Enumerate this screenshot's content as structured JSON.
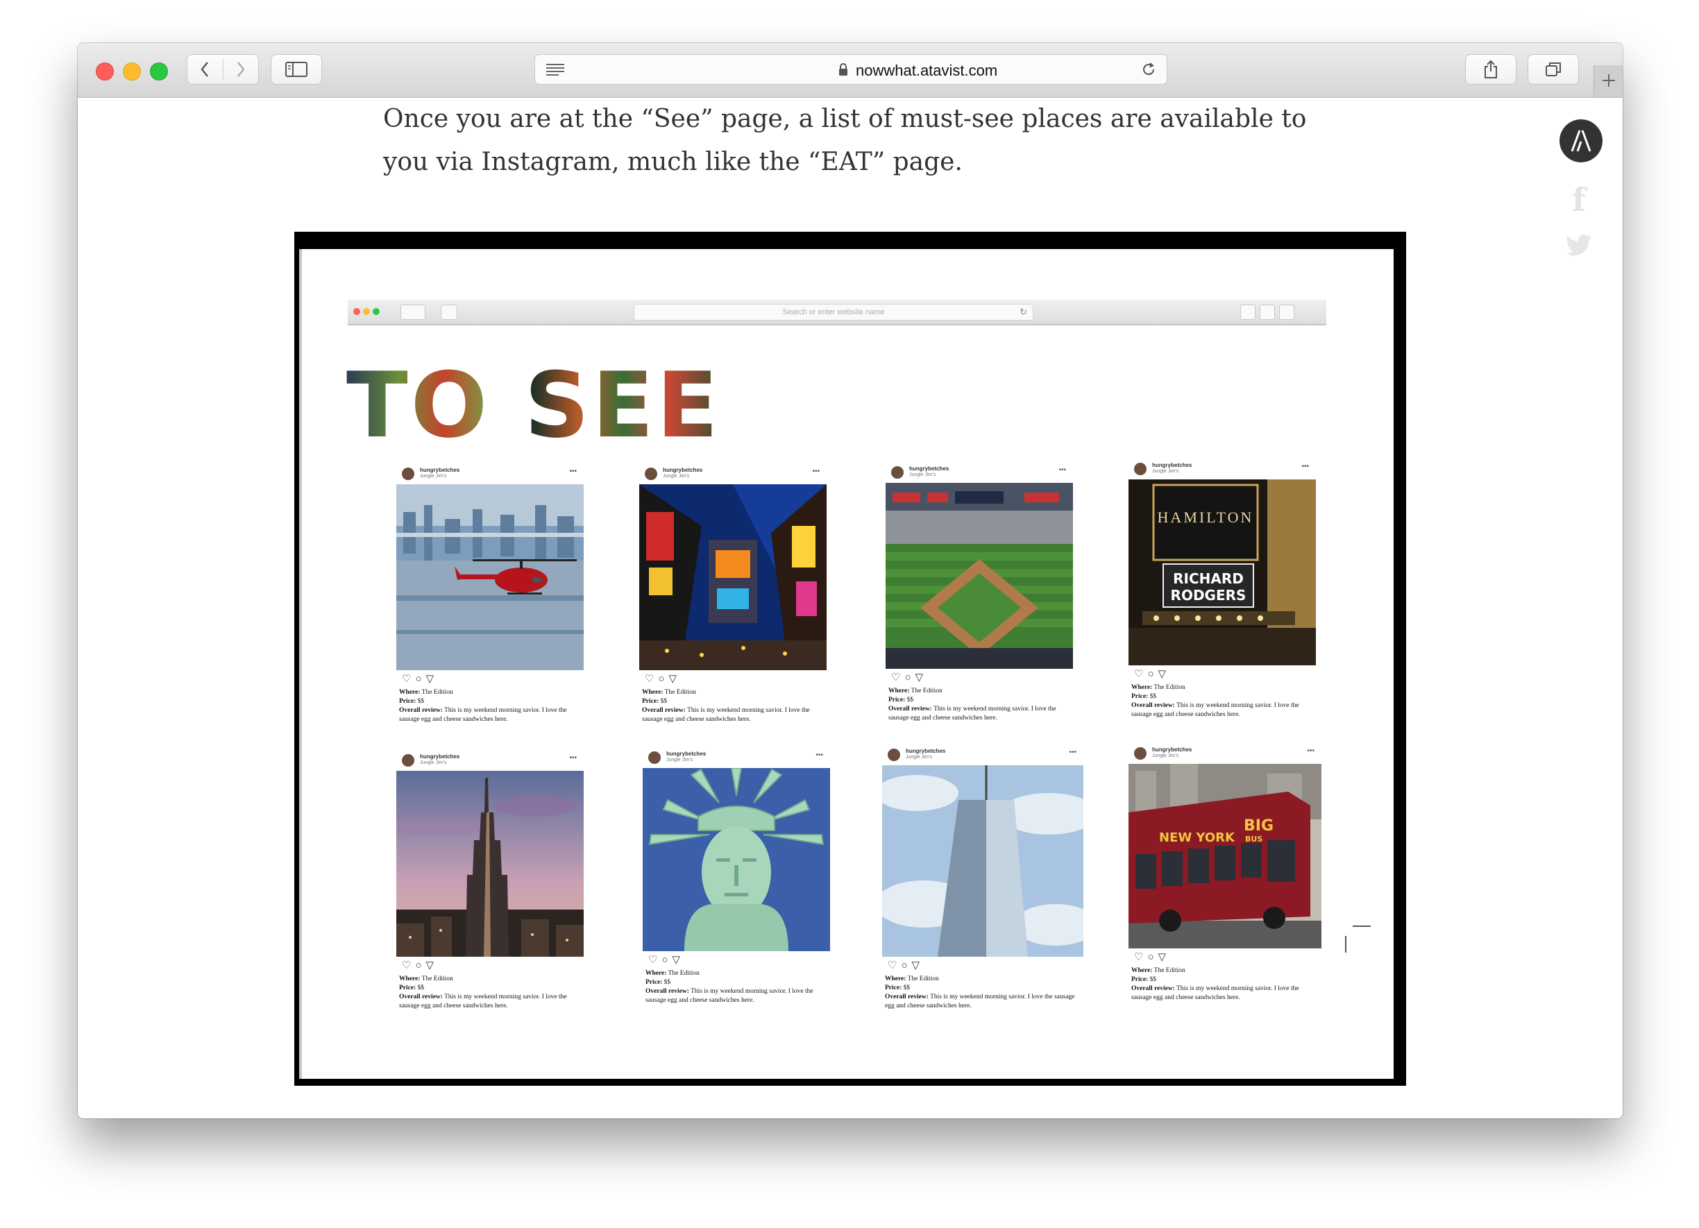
{
  "browser": {
    "url": "nowwhat.atavist.com",
    "mini_address_placeholder": "Search or enter website name"
  },
  "article": {
    "intro_text": "Once you are at the “See” page, a list of must-see places are available to you via Instagram, much like the “EAT” page."
  },
  "social": {
    "facebook_glyph": "f"
  },
  "screenshot": {
    "heading": "TO SEE",
    "posts": [
      {
        "user": "hungrybetches",
        "location": "Jungle Jim's",
        "image": "helicopter-over-city",
        "where_label": "Where:",
        "where": "The Edition",
        "price_label": "Price:",
        "price": "$$",
        "review_label": "Overall review:",
        "review": "This is my weekend morning savior. I love the sausage egg and cheese sandwiches here."
      },
      {
        "user": "hungrybetches",
        "location": "Jungle Jim's",
        "image": "times-square",
        "where_label": "Where:",
        "where": "The Edition",
        "price_label": "Price:",
        "price": "$$",
        "review_label": "Overall review:",
        "review": "This is my weekend morning savior. I love the sausage egg and cheese sandwiches here."
      },
      {
        "user": "hungrybetches",
        "location": "Jungle Jim's",
        "image": "yankee-stadium",
        "where_label": "Where:",
        "where": "The Edition",
        "price_label": "Price:",
        "price": "$$",
        "review_label": "Overall review:",
        "review": "This is my weekend morning savior. I love the sausage egg and cheese sandwiches here."
      },
      {
        "user": "hungrybetches",
        "location": "Jungle Jim's",
        "image": "hamilton-marquee",
        "sign_line1": "HAMILTON",
        "sign_line2": "RICHARD",
        "sign_line3": "RODGERS",
        "where_label": "Where:",
        "where": "The Edition",
        "price_label": "Price:",
        "price": "$$",
        "review_label": "Overall review:",
        "review": "This is my weekend morning savior. I love the sausage egg and cheese sandwiches here."
      },
      {
        "user": "hungrybetches",
        "location": "Jungle Jim's",
        "image": "empire-state-building",
        "where_label": "Where:",
        "where": "The Edition",
        "price_label": "Price:",
        "price": "$$",
        "review_label": "Overall review:",
        "review": "This is my weekend morning savior. I love the sausage egg and cheese sandwiches here."
      },
      {
        "user": "hungrybetches",
        "location": "Jungle Jim's",
        "image": "statue-of-liberty",
        "where_label": "Where:",
        "where": "The Edition",
        "price_label": "Price:",
        "price": "$$",
        "review_label": "Overall review:",
        "review": "This is my weekend morning savior. I love the sausage egg and cheese sandwiches here."
      },
      {
        "user": "hungrybetches",
        "location": "Jungle Jim's",
        "image": "one-world-trade-center",
        "where_label": "Where:",
        "where": "The Edition",
        "price_label": "Price:",
        "price": "$$",
        "review_label": "Overall review:",
        "review": "This is my weekend morning savior. I love the sausage egg and cheese sandwiches here."
      },
      {
        "user": "hungrybetches",
        "location": "Jungle Jim's",
        "image": "big-bus-tour",
        "sign_line1": "NEW YORK",
        "sign_line2": "BIG",
        "sign_line3": "BUS",
        "where_label": "Where:",
        "where": "The Edition",
        "price_label": "Price:",
        "price": "$$",
        "review_label": "Overall review:",
        "review": "This is my weekend morning savior. I love the sausage egg and cheese sandwiches here."
      }
    ]
  },
  "colors": {
    "close": "#fc5f57",
    "minimize": "#fdbc2e",
    "zoom": "#29c840",
    "text": "#333333",
    "logo_bg": "#333333",
    "frame_border": "#000000"
  },
  "icons": [
    "back-icon",
    "forward-icon",
    "sidebar-icon",
    "reader-icon",
    "lock-icon",
    "reload-icon",
    "share-icon",
    "tabs-icon",
    "plus-icon",
    "atavist-logo-icon",
    "facebook-icon",
    "twitter-icon",
    "heart-icon",
    "comment-icon",
    "send-icon"
  ]
}
